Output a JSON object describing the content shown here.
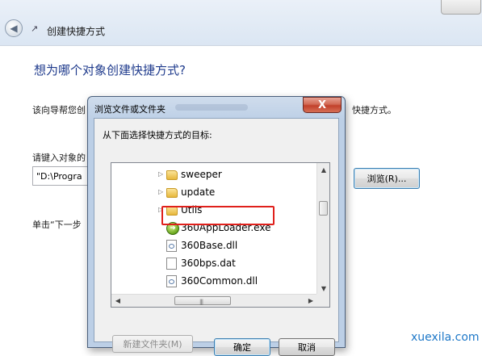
{
  "wizard": {
    "title": "创建快捷方式",
    "heading": "想为哪个对象创建快捷方式?",
    "description_start": "该向导帮您创",
    "description_end": "快捷方式。",
    "location_label_start": "请键入对象的",
    "location_value": "\"D:\\Progra",
    "next_instruction_start": "单击“下一步",
    "browse_label": "浏览(R)..."
  },
  "dialog": {
    "title": "浏览文件或文件夹",
    "prompt": "从下面选择快捷方式的目标:",
    "close_glyph": "X",
    "items": [
      {
        "label": "sweeper",
        "kind": "folder",
        "expandable": true
      },
      {
        "label": "update",
        "kind": "folder",
        "expandable": true
      },
      {
        "label": "Utils",
        "kind": "folder",
        "expandable": true
      },
      {
        "label": "360AppLoader.exe",
        "kind": "exe",
        "selected": true
      },
      {
        "label": "360Base.dll",
        "kind": "dll"
      },
      {
        "label": "360bps.dat",
        "kind": "file"
      },
      {
        "label": "360Common.dll",
        "kind": "dll"
      }
    ],
    "new_folder_label": "新建文件夹(M)",
    "ok_label": "确定",
    "cancel_label": "取消"
  },
  "watermark": "xuexila.com"
}
